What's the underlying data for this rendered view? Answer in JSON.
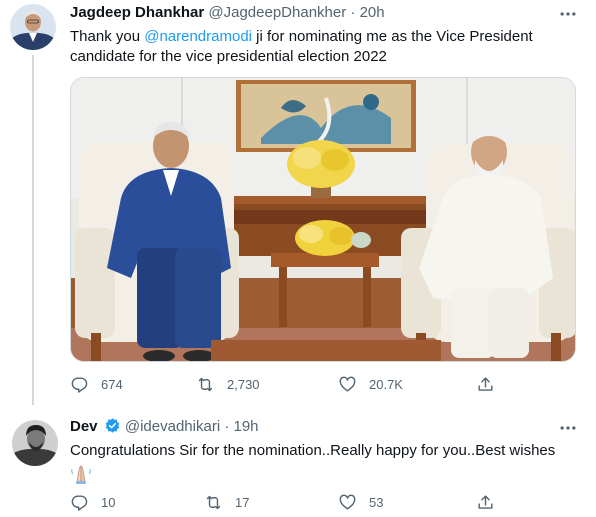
{
  "tweets": [
    {
      "author_name": "Jagdeep Dhankhar",
      "handle": "@JagdeepDhankher",
      "separator": "·",
      "time": "20h",
      "text_before": "Thank you ",
      "mention": "@narendramodi",
      "text_after": " ji for nominating me as the Vice President candidate for the vice presidential election 2022",
      "verified": false,
      "stats": {
        "replies": "674",
        "retweets": "2,730",
        "likes": "20.7K"
      }
    },
    {
      "author_name": "Dev",
      "handle": "@idevadhikari",
      "separator": "·",
      "time": "19h",
      "text": "Congratulations Sir for the nomination..Really happy for you..Best wishes",
      "verified": true,
      "stats": {
        "replies": "10",
        "retweets": "17",
        "likes": "53"
      }
    }
  ],
  "icons": {
    "reply": "reply-icon",
    "retweet": "retweet-icon",
    "like": "like-icon",
    "share": "share-icon",
    "more": "more-icon",
    "verified": "verified-badge-icon",
    "emoji": "folded-hands-emoji"
  },
  "colors": {
    "accent": "#1d9bf0",
    "muted": "#536471",
    "text": "#0f1419",
    "border": "#cfd9de"
  }
}
